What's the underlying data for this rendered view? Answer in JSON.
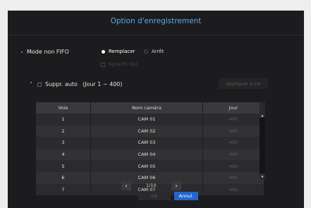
{
  "dialog": {
    "title": "Option d'enregistrement",
    "mode_label": "Mode non FIFO",
    "mode_options": [
      {
        "label": "Remplacer",
        "selected": true
      },
      {
        "label": "Arrêt",
        "selected": false
      }
    ],
    "signal_label": "Signal fin disq",
    "autodelete_label": "Suppr. auto",
    "autodelete_range": "(Jour 1 ~ 400)",
    "apply_label": "Appliquer à CH",
    "table": {
      "headers": [
        "Voie",
        "Nom caméra",
        "Jour"
      ],
      "rows": [
        {
          "voie": "1",
          "name": "CAM 01",
          "jour": "400"
        },
        {
          "voie": "2",
          "name": "CAM 02",
          "jour": "400"
        },
        {
          "voie": "3",
          "name": "CAM 03",
          "jour": "400"
        },
        {
          "voie": "4",
          "name": "CAM 04",
          "jour": "400"
        },
        {
          "voie": "5",
          "name": "CAM 05",
          "jour": "400"
        },
        {
          "voie": "6",
          "name": "CAM 06",
          "jour": "400"
        },
        {
          "voie": "7",
          "name": "CAM 07",
          "jour": "400"
        }
      ]
    },
    "pagination": {
      "prev_icon": "chevron-left-icon",
      "next_icon": "chevron-right-icon",
      "text": "1/10"
    },
    "ok_label": "OK",
    "cancel_label": "Annul.",
    "colors": {
      "accent": "#5fa8e8",
      "primary_button": "#2266cc",
      "background": "#1c1c1e"
    }
  }
}
